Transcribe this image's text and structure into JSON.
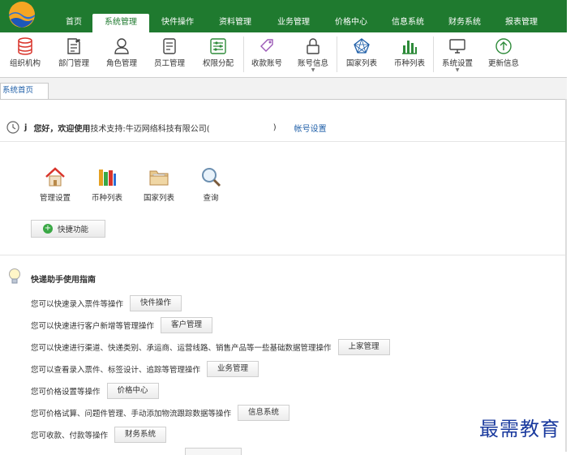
{
  "menu": [
    {
      "label": "首页",
      "active": false
    },
    {
      "label": "系统管理",
      "active": true
    },
    {
      "label": "快件操作",
      "active": false
    },
    {
      "label": "资料管理",
      "active": false
    },
    {
      "label": "业务管理",
      "active": false
    },
    {
      "label": "价格中心",
      "active": false
    },
    {
      "label": "信息系统",
      "active": false
    },
    {
      "label": "财务系统",
      "active": false
    },
    {
      "label": "报表管理",
      "active": false
    }
  ],
  "toolbar": [
    {
      "label": "组织机构",
      "icon": "database-icon"
    },
    {
      "label": "部门管理",
      "icon": "edit-doc-icon"
    },
    {
      "label": "角色管理",
      "icon": "user-icon"
    },
    {
      "label": "员工管理",
      "icon": "staff-doc-icon"
    },
    {
      "label": "权限分配",
      "icon": "permission-icon"
    },
    {
      "label": "收款账号",
      "icon": "tag-icon"
    },
    {
      "label": "账号信息",
      "icon": "lock-icon",
      "dropdown": true
    },
    {
      "label": "国家列表",
      "icon": "network-icon"
    },
    {
      "label": "币种列表",
      "icon": "bar-chart-icon"
    },
    {
      "label": "系统设置",
      "icon": "monitor-icon",
      "dropdown": true
    },
    {
      "label": "更新信息",
      "icon": "upload-icon"
    }
  ],
  "tab": {
    "label": "系统首页"
  },
  "welcome": {
    "user": "j",
    "greeting": "您好，欢迎使用",
    "support": "技术支持:牛迈网络科技有限公司(",
    "close_paren": ")",
    "account_link": "帐号设置"
  },
  "shortcuts": [
    {
      "label": "管理设置",
      "icon": "house-icon"
    },
    {
      "label": "币种列表",
      "icon": "books-icon"
    },
    {
      "label": "国家列表",
      "icon": "folder-icon"
    },
    {
      "label": "查询",
      "icon": "magnifier-icon"
    }
  ],
  "quick_button": "快捷功能",
  "guide": {
    "title": "快递助手使用指南",
    "rows": [
      {
        "text": "您可以快速录入票件等操作",
        "button": "快件操作"
      },
      {
        "text": "您可以快速进行客户新增等管理操作",
        "button": "客户管理"
      },
      {
        "text": "您可以快速进行渠道、快递类别、承运商、运营线路、销售产品等一些基础数据管理操作",
        "button": "上家管理"
      },
      {
        "text": "您可以查看录入票件、标签设计、追踪等管理操作",
        "button": "业务管理"
      },
      {
        "text": "您可价格设置等操作",
        "button": "价格中心"
      },
      {
        "text": "您可价格试算、问题件管理、手动添加物流跟踪数据等操作",
        "button": "信息系统"
      },
      {
        "text": "您可收款、付款等操作",
        "button": "财务系统"
      }
    ]
  },
  "watermark": "最需教育",
  "colors": {
    "brand_green": "#1f7a2f",
    "link_blue": "#1f5fa8",
    "watermark_blue": "#1a3a9e"
  }
}
